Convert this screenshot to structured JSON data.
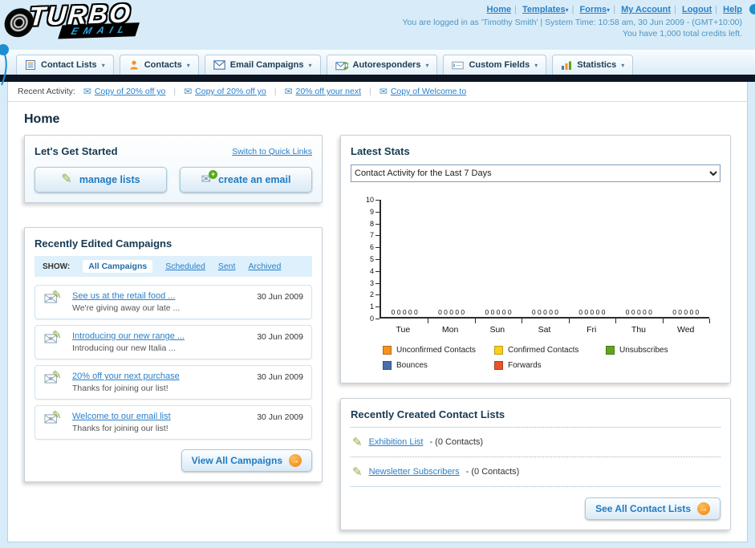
{
  "header": {
    "logo": {
      "line1": "TURBO",
      "line2": "EMAIL"
    },
    "nav_links": [
      {
        "label": "Home",
        "dropdown": false
      },
      {
        "label": "Templates",
        "dropdown": true
      },
      {
        "label": "Forms",
        "dropdown": true
      },
      {
        "label": "My Account",
        "dropdown": false
      },
      {
        "label": "Logout",
        "dropdown": false
      },
      {
        "label": "Help",
        "dropdown": false
      }
    ],
    "login_info": "You are logged in as 'Timothy Smith' | System Time: 10:58 am, 30 Jun 2009 - (GMT+10:00)",
    "credits_info": "You have 1,000 total credits left."
  },
  "nav_tabs": [
    {
      "label": "Contact Lists",
      "icon": "contact-lists-icon"
    },
    {
      "label": "Contacts",
      "icon": "contacts-icon"
    },
    {
      "label": "Email Campaigns",
      "icon": "email-campaigns-icon"
    },
    {
      "label": "Autoresponders",
      "icon": "autoresponders-icon"
    },
    {
      "label": "Custom Fields",
      "icon": "custom-fields-icon"
    },
    {
      "label": "Statistics",
      "icon": "statistics-icon"
    }
  ],
  "recent_activity": {
    "label": "Recent Activity:",
    "items": [
      "Copy of 20% off yo",
      "Copy of 20% off yo",
      "20% off your next",
      "Copy of Welcome to"
    ]
  },
  "page_title": "Home",
  "get_started": {
    "title": "Let's Get Started",
    "switch_link": "Switch to Quick Links",
    "manage_lists_label": "manage lists",
    "create_email_label": "create an email"
  },
  "campaigns": {
    "title": "Recently Edited Campaigns",
    "show_label": "SHOW:",
    "tabs": [
      "All Campaigns",
      "Scheduled",
      "Sent",
      "Archived"
    ],
    "active_tab": "All Campaigns",
    "items": [
      {
        "title": "See us at the retail food ...",
        "subtitle": "We're giving away our late ...",
        "date": "30 Jun 2009"
      },
      {
        "title": "Introducing our new range ...",
        "subtitle": "Introducing our new Italia ...",
        "date": "30 Jun 2009"
      },
      {
        "title": "20% off your next purchase",
        "subtitle": "Thanks for joining our list!",
        "date": "30 Jun 2009"
      },
      {
        "title": "Welcome to our email list",
        "subtitle": "Thanks for joining our list!",
        "date": "30 Jun 2009"
      }
    ],
    "view_all_label": "View All Campaigns"
  },
  "latest_stats": {
    "title": "Latest Stats",
    "dropdown_value": "Contact Activity for the Last 7 Days",
    "chart_data": {
      "type": "bar",
      "categories": [
        "Tue",
        "Mon",
        "Sun",
        "Sat",
        "Fri",
        "Thu",
        "Wed"
      ],
      "series": [
        {
          "name": "Unconfirmed Contacts",
          "color": "#f6921e",
          "values": [
            0,
            0,
            0,
            0,
            0,
            0,
            0
          ]
        },
        {
          "name": "Confirmed Contacts",
          "color": "#fdd017",
          "values": [
            0,
            0,
            0,
            0,
            0,
            0,
            0
          ]
        },
        {
          "name": "Unsubscribes",
          "color": "#60a41c",
          "values": [
            0,
            0,
            0,
            0,
            0,
            0,
            0
          ]
        },
        {
          "name": "Bounces",
          "color": "#4a6fa9",
          "values": [
            0,
            0,
            0,
            0,
            0,
            0,
            0
          ]
        },
        {
          "name": "Forwards",
          "color": "#e8532a",
          "values": [
            0,
            0,
            0,
            0,
            0,
            0,
            0
          ]
        }
      ],
      "ylim": [
        0,
        10
      ],
      "yticks": [
        0,
        1,
        2,
        3,
        4,
        5,
        6,
        7,
        8,
        9,
        10
      ],
      "grid": false,
      "legend_position": "bottom"
    }
  },
  "contact_lists": {
    "title": "Recently Created Contact Lists",
    "items": [
      {
        "name": "Exhibition List",
        "detail": "- (0 Contacts)"
      },
      {
        "name": "Newsletter Subscribers",
        "detail": "- (0 Contacts)"
      }
    ],
    "see_all_label": "See All Contact Lists"
  }
}
